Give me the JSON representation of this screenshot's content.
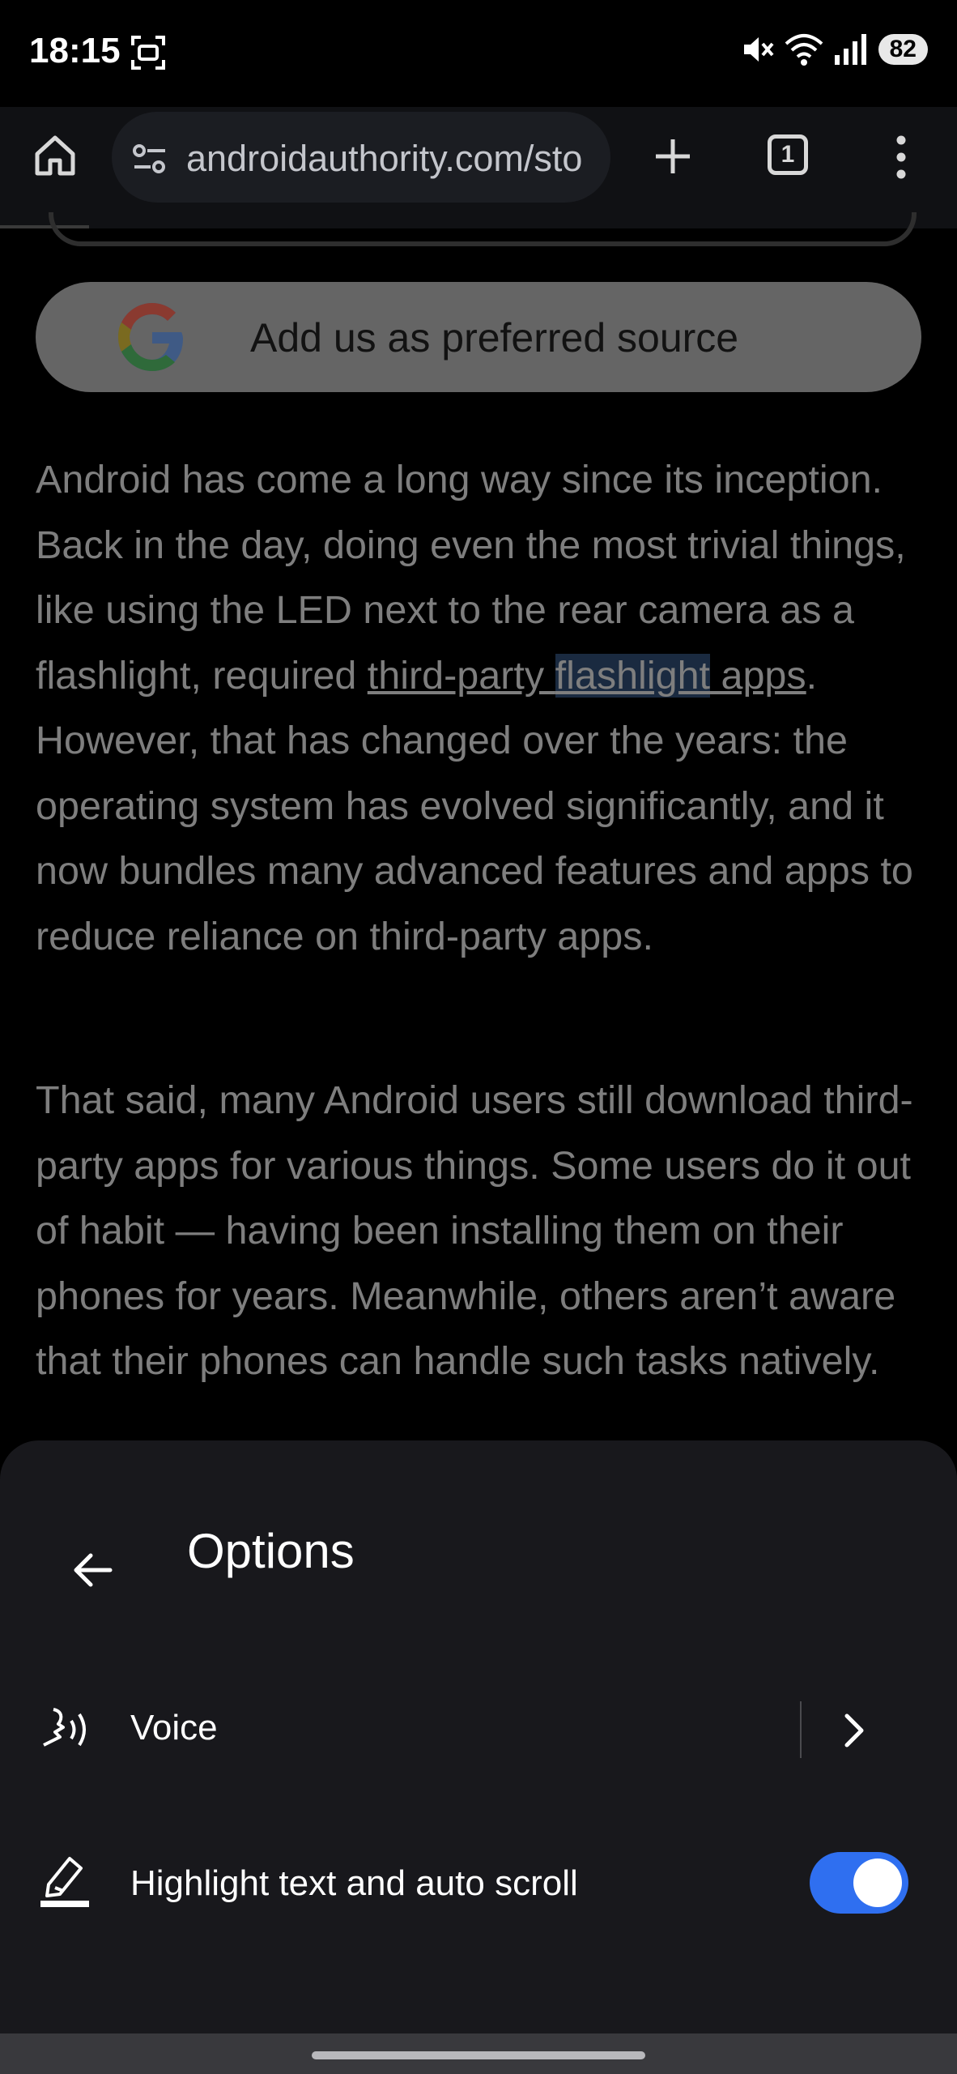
{
  "status_bar": {
    "time": "18:15",
    "battery": "82",
    "icons": [
      "screenshot-icon",
      "mute-icon",
      "wifi-icon",
      "signal-icon",
      "battery-icon"
    ]
  },
  "browser": {
    "url": "androidauthority.com/sto",
    "tab_count": "1",
    "icons": [
      "home-icon",
      "site-settings-icon",
      "new-tab-icon",
      "tab-switcher-icon",
      "more-menu-icon"
    ]
  },
  "article": {
    "preferred_source_button": "Add us as preferred source",
    "para1_before_link": "Android has come a long way since its inception. Back in the day, doing even the most trivial things, like using the LED next to the rear camera as a flashlight, required ",
    "link1_part1": "third-party ",
    "link1_highlight": "flashlight",
    "link1_part2": " apps",
    "para1_after_link": ". However, that has changed over the years: the operating system has evolved significantly, and it now bundles many advanced features and apps to reduce reliance on third-party apps.",
    "para2": "That said, many Android users still download third-party apps for various things. Some users do it out of habit — having been installing them on their phones for years. Meanwhile, others aren’t aware that their phones can handle such tasks natively."
  },
  "options_sheet": {
    "title": "Options",
    "voice_label": "Voice",
    "highlight_label": "Highlight text and auto scroll",
    "highlight_enabled": true
  },
  "colors": {
    "accent": "#2f6ff0",
    "sheet_bg": "#18181c",
    "toolbar_bg": "#101114"
  }
}
